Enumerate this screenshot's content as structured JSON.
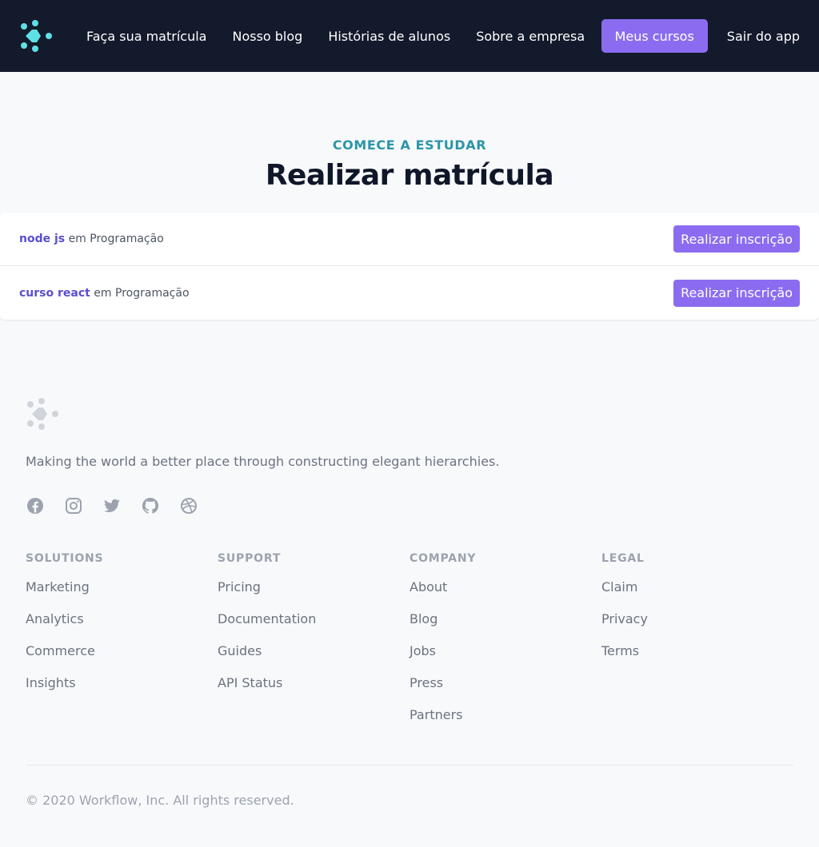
{
  "nav": {
    "logo_icon": "workflow-logo-icon",
    "links": [
      "Faça sua matrícula",
      "Nosso blog",
      "Histórias de alunos",
      "Sobre a empresa"
    ],
    "my_courses_label": "Meus cursos",
    "exit_label": "Sair do app"
  },
  "hero": {
    "eyebrow": "Comece a estudar",
    "title": "Realizar matrícula"
  },
  "courses": [
    {
      "name": "node js",
      "connector": "em",
      "category": "Programação",
      "button_label": "Realizar inscrição"
    },
    {
      "name": "curso react",
      "connector": "em",
      "category": "Programação",
      "button_label": "Realizar inscrição"
    }
  ],
  "footer": {
    "tagline": "Making the world a better place through constructing elegant hierarchies.",
    "social_icons": [
      "facebook-icon",
      "instagram-icon",
      "twitter-icon",
      "github-icon",
      "dribbble-icon"
    ],
    "columns": [
      {
        "heading": "Solutions",
        "links": [
          "Marketing",
          "Analytics",
          "Commerce",
          "Insights"
        ]
      },
      {
        "heading": "Support",
        "links": [
          "Pricing",
          "Documentation",
          "Guides",
          "API Status"
        ]
      },
      {
        "heading": "Company",
        "links": [
          "About",
          "Blog",
          "Jobs",
          "Press",
          "Partners"
        ]
      },
      {
        "heading": "Legal",
        "links": [
          "Claim",
          "Privacy",
          "Terms"
        ]
      }
    ],
    "copyright": "© 2020 Workflow, Inc. All rights reserved."
  },
  "colors": {
    "nav_bg": "#131a2c",
    "accent": "#8b6cf0",
    "eyebrow": "#2b95a9",
    "course_name": "#5a4fcf",
    "logo_primary": "#5ee0e6",
    "logo_footer": "#d1d5db"
  }
}
